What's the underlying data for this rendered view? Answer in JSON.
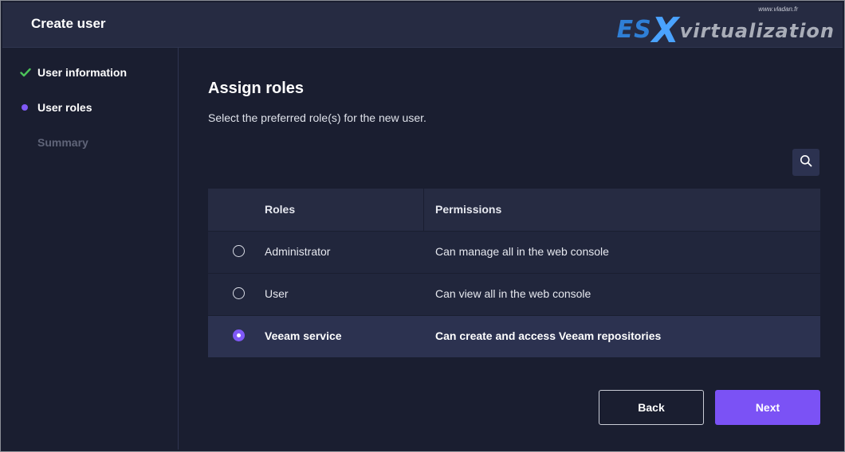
{
  "header": {
    "title": "Create user",
    "watermark_site": "www.vladan.fr",
    "watermark_es": "ES",
    "watermark_x": "X",
    "watermark_rest": "virtualization"
  },
  "wizard": {
    "steps": [
      {
        "label": "User information",
        "state": "completed",
        "icon": "check-icon"
      },
      {
        "label": "User roles",
        "state": "current",
        "icon": "dot-icon"
      },
      {
        "label": "Summary",
        "state": "pending"
      }
    ]
  },
  "main": {
    "title": "Assign roles",
    "subtitle": "Select the preferred role(s) for the new user.",
    "search_icon": "search-icon"
  },
  "table": {
    "headers": {
      "roles": "Roles",
      "permissions": "Permissions"
    },
    "rows": [
      {
        "role": "Administrator",
        "permission": "Can manage all in the web console",
        "selected": false
      },
      {
        "role": "User",
        "permission": "Can view all in the web console",
        "selected": false
      },
      {
        "role": "Veeam service",
        "permission": "Can create and access Veeam repositories",
        "selected": true
      }
    ]
  },
  "buttons": {
    "back": "Back",
    "next": "Next"
  },
  "colors": {
    "accent": "#7b52f5",
    "success": "#4cc35a",
    "background": "#1a1e30",
    "header": "#262b42"
  }
}
